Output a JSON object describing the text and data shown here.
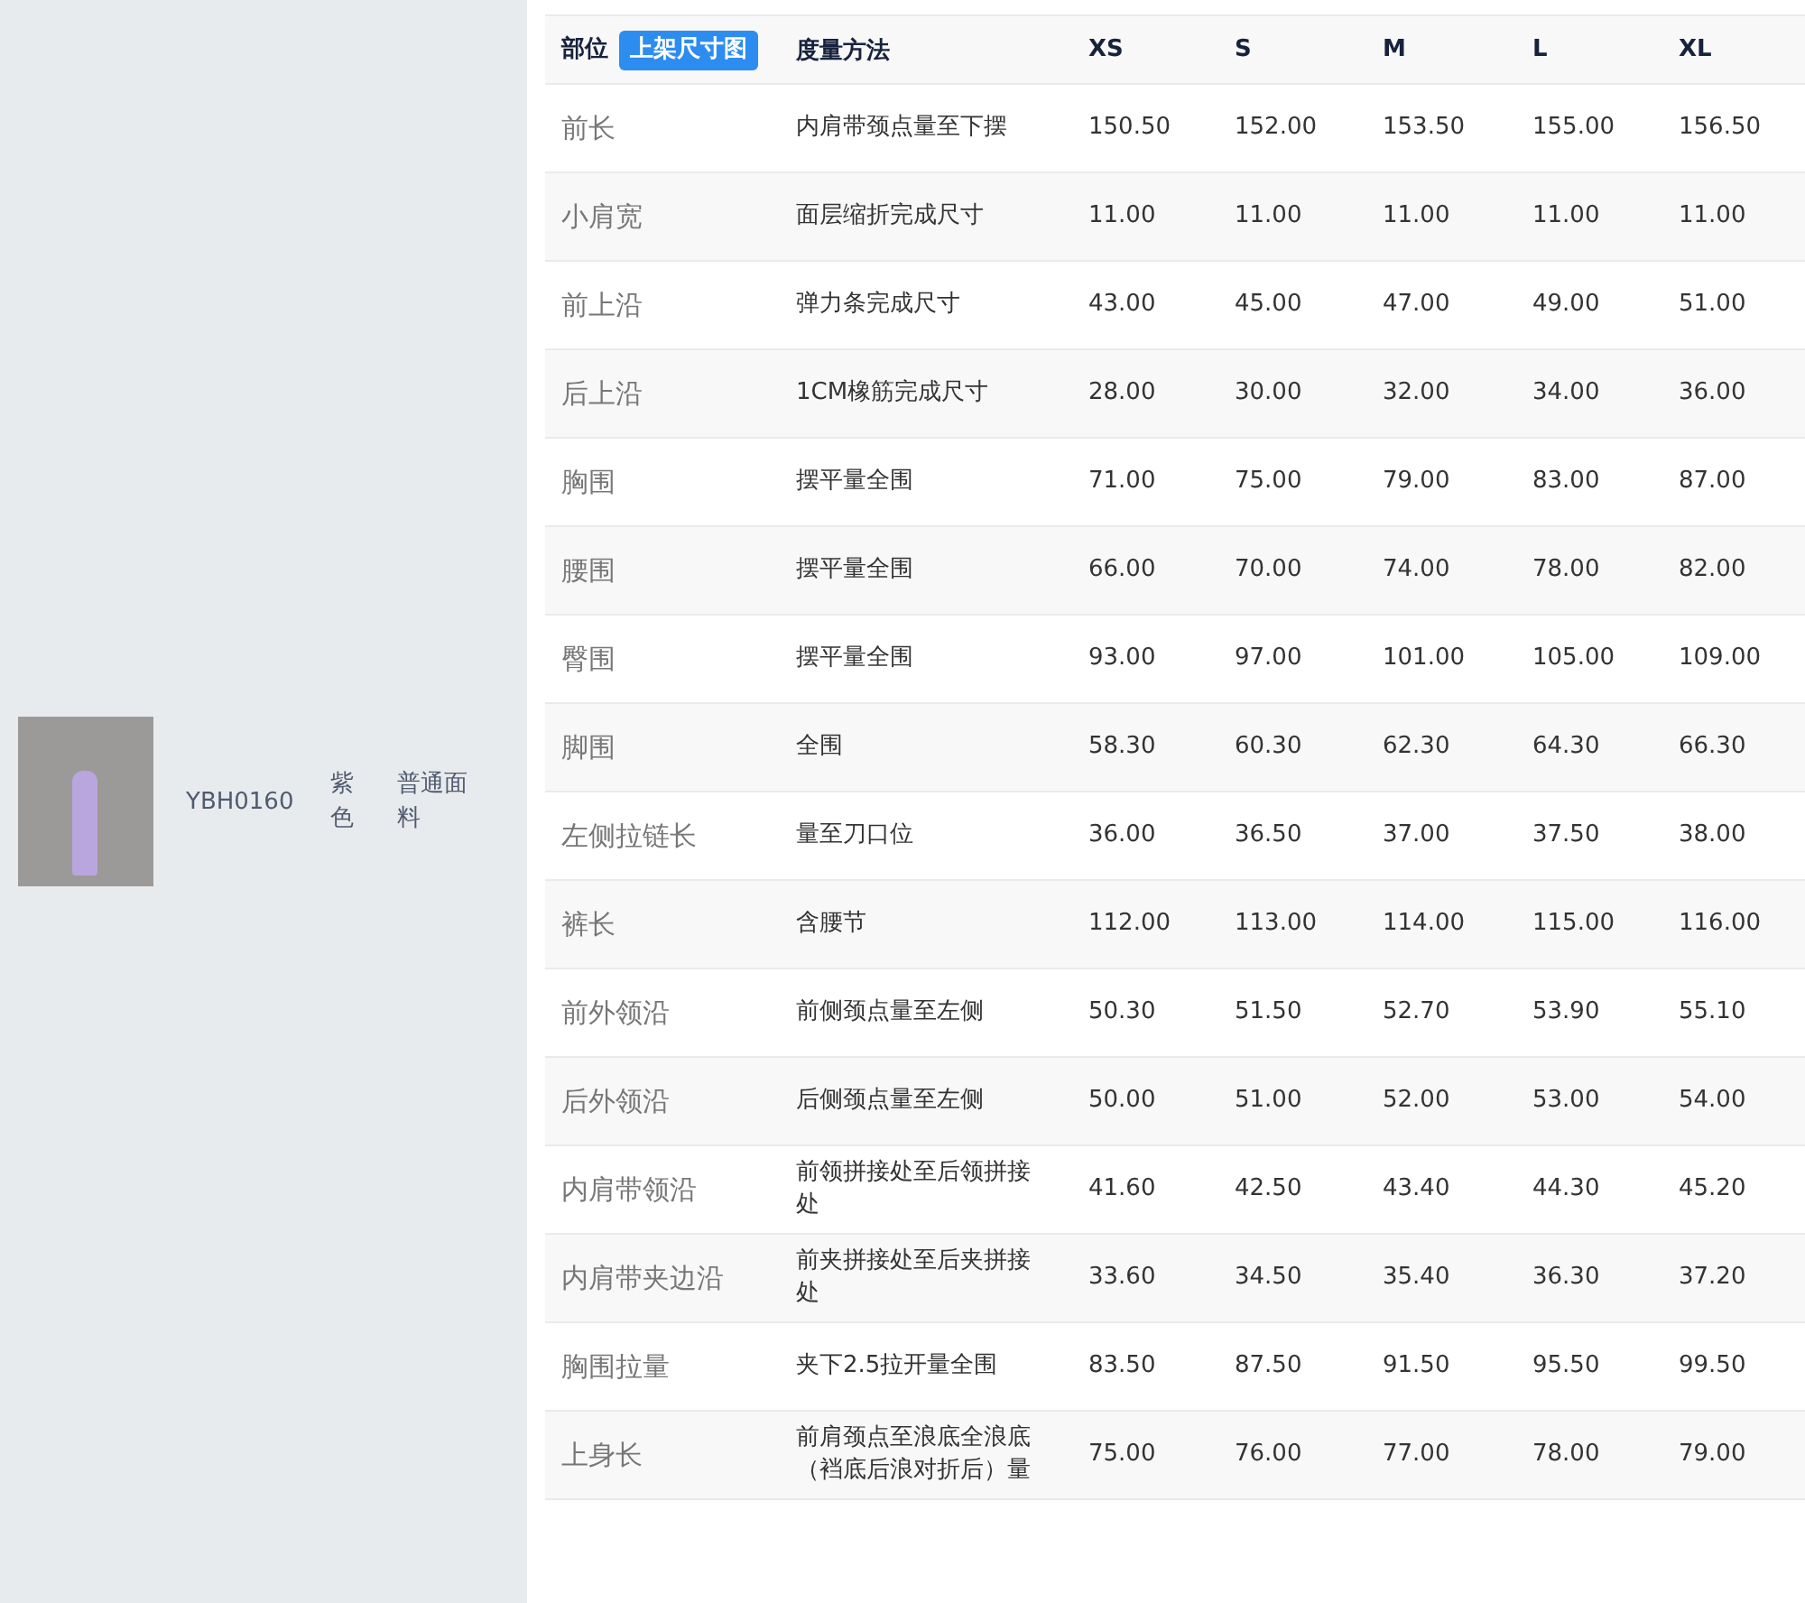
{
  "product": {
    "code": "YBH0160",
    "variant": "紫色",
    "fabric": "普通面料"
  },
  "table": {
    "badge": "上架尺寸图",
    "columns": [
      "部位",
      "度量方法",
      "XS",
      "S",
      "M",
      "L",
      "XL"
    ],
    "rows": [
      {
        "part": "前长",
        "method": "内肩带颈点量至下摆",
        "values": [
          "150.50",
          "152.00",
          "153.50",
          "155.00",
          "156.50"
        ]
      },
      {
        "part": "小肩宽",
        "method": "面层缩折完成尺寸",
        "values": [
          "11.00",
          "11.00",
          "11.00",
          "11.00",
          "11.00"
        ]
      },
      {
        "part": "前上沿",
        "method": "弹力条完成尺寸",
        "values": [
          "43.00",
          "45.00",
          "47.00",
          "49.00",
          "51.00"
        ]
      },
      {
        "part": "后上沿",
        "method": "1CM橡筋完成尺寸",
        "values": [
          "28.00",
          "30.00",
          "32.00",
          "34.00",
          "36.00"
        ]
      },
      {
        "part": "胸围",
        "method": "摆平量全围",
        "values": [
          "71.00",
          "75.00",
          "79.00",
          "83.00",
          "87.00"
        ]
      },
      {
        "part": "腰围",
        "method": "摆平量全围",
        "values": [
          "66.00",
          "70.00",
          "74.00",
          "78.00",
          "82.00"
        ]
      },
      {
        "part": "臀围",
        "method": "摆平量全围",
        "values": [
          "93.00",
          "97.00",
          "101.00",
          "105.00",
          "109.00"
        ]
      },
      {
        "part": "脚围",
        "method": "全围",
        "values": [
          "58.30",
          "60.30",
          "62.30",
          "64.30",
          "66.30"
        ]
      },
      {
        "part": "左侧拉链长",
        "method": "量至刀口位",
        "values": [
          "36.00",
          "36.50",
          "37.00",
          "37.50",
          "38.00"
        ]
      },
      {
        "part": "裤长",
        "method": "含腰节",
        "values": [
          "112.00",
          "113.00",
          "114.00",
          "115.00",
          "116.00"
        ]
      },
      {
        "part": "前外领沿",
        "method": "前侧颈点量至左侧",
        "values": [
          "50.30",
          "51.50",
          "52.70",
          "53.90",
          "55.10"
        ]
      },
      {
        "part": "后外领沿",
        "method": "后侧颈点量至左侧",
        "values": [
          "50.00",
          "51.00",
          "52.00",
          "53.00",
          "54.00"
        ]
      },
      {
        "part": "内肩带领沿",
        "method": "前领拼接处至后领拼接处",
        "values": [
          "41.60",
          "42.50",
          "43.40",
          "44.30",
          "45.20"
        ]
      },
      {
        "part": "内肩带夹边沿",
        "method": "前夹拼接处至后夹拼接处",
        "values": [
          "33.60",
          "34.50",
          "35.40",
          "36.30",
          "37.20"
        ]
      },
      {
        "part": "胸围拉量",
        "method": "夹下2.5拉开量全围",
        "values": [
          "83.50",
          "87.50",
          "91.50",
          "95.50",
          "99.50"
        ]
      },
      {
        "part": "上身长",
        "method": "前肩颈点至浪底全浪底（裆底后浪对折后）量",
        "values": [
          "75.00",
          "76.00",
          "77.00",
          "78.00",
          "79.00"
        ]
      }
    ]
  }
}
